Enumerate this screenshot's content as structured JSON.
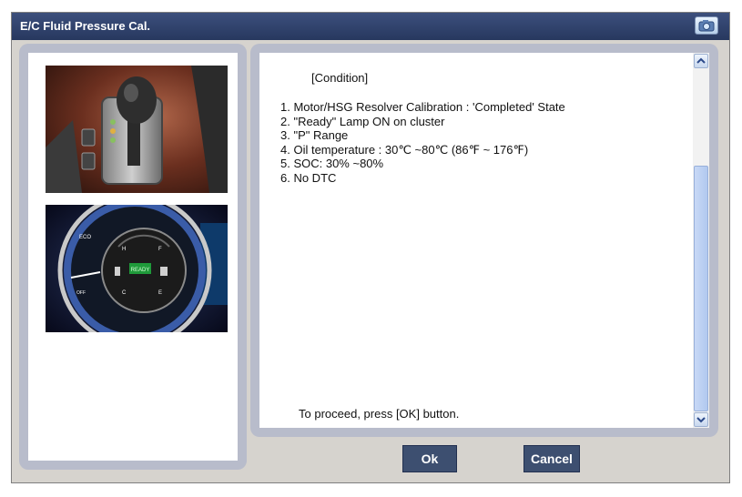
{
  "window": {
    "title": "E/C Fluid Pressure Cal."
  },
  "icons": {
    "camera": "camera-icon",
    "scroll_up": "chevron-up-icon",
    "scroll_down": "chevron-down-icon"
  },
  "images": [
    {
      "name": "gear-shifter-photo"
    },
    {
      "name": "instrument-cluster-photo",
      "labels": {
        "eco": "ECO",
        "ready": "READY",
        "off": "OFF",
        "h": "H",
        "c": "C",
        "f": "F",
        "e": "E"
      }
    }
  ],
  "content": {
    "condition_heading": "[Condition]",
    "items": [
      "1. Motor/HSG Resolver Calibration : 'Completed' State",
      "2. \"Ready\" Lamp ON on cluster",
      "3. \"P\" Range",
      "4. Oil temperature : 30℃ ~80℃ (86℉ ~ 176℉)",
      "5. SOC: 30% ~80%",
      "6. No DTC"
    ],
    "proceed": "To proceed, press [OK] button."
  },
  "buttons": {
    "ok": "Ok",
    "cancel": "Cancel"
  },
  "colors": {
    "titlebar": "#2f4270",
    "button": "#3d4f70",
    "panel": "#b8bccb"
  }
}
